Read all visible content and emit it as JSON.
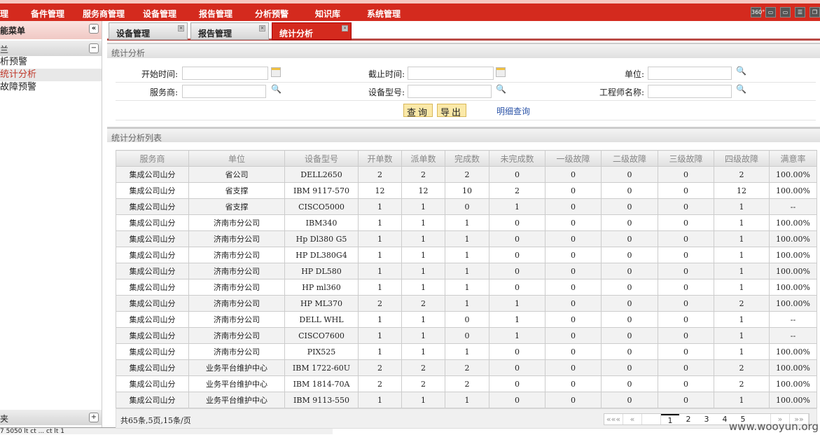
{
  "topnav": [
    "理",
    "备件管理",
    "服务商管理",
    "设备管理",
    "报告管理",
    "分析预警",
    "知识库",
    "系统管理"
  ],
  "top_icons": [
    "360-icon",
    "layout-icon",
    "window-icon",
    "list-icon",
    "restore-icon"
  ],
  "top_icon_360": "360°",
  "sidebar": {
    "title": "能菜单",
    "section": "兰",
    "items": [
      "析预警",
      "统计分析",
      "故障预警"
    ],
    "bottom_section": "夹",
    "bottom_text": "7 5050 lt ct ... ct lt 1 "
  },
  "tabs": [
    {
      "label": "设备管理"
    },
    {
      "label": "报告管理"
    },
    {
      "label": "统计分析"
    }
  ],
  "query_panel": {
    "title": "统计分析",
    "start_label": "开始时间:",
    "end_label": "截止时间:",
    "unit_label": "单位:",
    "provider_label": "服务商:",
    "model_label": "设备型号:",
    "engineer_label": "工程师名称:",
    "query_button": "查询",
    "export_button": "导出",
    "detail_link": "明细查询"
  },
  "list_panel": {
    "title": "统计分析列表"
  },
  "table": {
    "headers": [
      "服务商",
      "单位",
      "设备型号",
      "开单数",
      "派单数",
      "完成数",
      "未完成数",
      "一级故障",
      "二级故障",
      "三级故障",
      "四级故障",
      "满意率"
    ],
    "rows": [
      [
        "集成公司山分",
        "省公司",
        "DELL2650",
        "2",
        "2",
        "2",
        "0",
        "0",
        "0",
        "0",
        "2",
        "100.00%"
      ],
      [
        "集成公司山分",
        "省支撑",
        "IBM 9117-570",
        "12",
        "12",
        "10",
        "2",
        "0",
        "0",
        "0",
        "12",
        "100.00%"
      ],
      [
        "集成公司山分",
        "省支撑",
        "CISCO5000",
        "1",
        "1",
        "0",
        "1",
        "0",
        "0",
        "0",
        "1",
        "--"
      ],
      [
        "集成公司山分",
        "济南市分公司",
        "IBM340",
        "1",
        "1",
        "1",
        "0",
        "0",
        "0",
        "0",
        "1",
        "100.00%"
      ],
      [
        "集成公司山分",
        "济南市分公司",
        "Hp Dl380 G5",
        "1",
        "1",
        "1",
        "0",
        "0",
        "0",
        "0",
        "1",
        "100.00%"
      ],
      [
        "集成公司山分",
        "济南市分公司",
        "HP DL380G4",
        "1",
        "1",
        "1",
        "0",
        "0",
        "0",
        "0",
        "1",
        "100.00%"
      ],
      [
        "集成公司山分",
        "济南市分公司",
        "HP DL580",
        "1",
        "1",
        "1",
        "0",
        "0",
        "0",
        "0",
        "1",
        "100.00%"
      ],
      [
        "集成公司山分",
        "济南市分公司",
        "HP ml360",
        "1",
        "1",
        "1",
        "0",
        "0",
        "0",
        "0",
        "1",
        "100.00%"
      ],
      [
        "集成公司山分",
        "济南市分公司",
        "HP ML370",
        "2",
        "2",
        "1",
        "1",
        "0",
        "0",
        "0",
        "2",
        "100.00%"
      ],
      [
        "集成公司山分",
        "济南市分公司",
        "DELL WHL",
        "1",
        "1",
        "0",
        "1",
        "0",
        "0",
        "0",
        "1",
        "--"
      ],
      [
        "集成公司山分",
        "济南市分公司",
        "CISCO7600",
        "1",
        "1",
        "0",
        "1",
        "0",
        "0",
        "0",
        "1",
        "--"
      ],
      [
        "集成公司山分",
        "济南市分公司",
        "PIX525",
        "1",
        "1",
        "1",
        "0",
        "0",
        "0",
        "0",
        "1",
        "100.00%"
      ],
      [
        "集成公司山分",
        "业务平台维护中心",
        "IBM 1722-60U",
        "2",
        "2",
        "2",
        "0",
        "0",
        "0",
        "0",
        "2",
        "100.00%"
      ],
      [
        "集成公司山分",
        "业务平台维护中心",
        "IBM 1814-70A",
        "2",
        "2",
        "2",
        "0",
        "0",
        "0",
        "0",
        "2",
        "100.00%"
      ],
      [
        "集成公司山分",
        "业务平台维护中心",
        "IBM 9113-550",
        "1",
        "1",
        "1",
        "0",
        "0",
        "0",
        "0",
        "1",
        "100.00%"
      ]
    ]
  },
  "pager": {
    "info": "共65条,5页,15条/页",
    "first": "«««",
    "prev": "«",
    "next": "»",
    "last": "»»",
    "pages": [
      "1",
      "2",
      "3",
      "4",
      "5"
    ],
    "current": "1"
  },
  "watermark": "www.wooyun.org"
}
